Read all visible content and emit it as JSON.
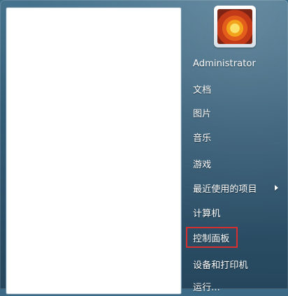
{
  "user": {
    "name": "Administrator"
  },
  "menu": {
    "items": [
      {
        "label": "文档",
        "submenu": false
      },
      {
        "label": "图片",
        "submenu": false
      },
      {
        "label": "音乐",
        "submenu": false
      },
      {
        "label": "游戏",
        "submenu": false
      },
      {
        "label": "最近使用的项目",
        "submenu": true
      },
      {
        "label": "计算机",
        "submenu": false
      },
      {
        "label": "控制面板",
        "submenu": false,
        "highlighted": true
      },
      {
        "label": "设备和打印机",
        "submenu": false
      },
      {
        "label": "运行...",
        "submenu": false
      }
    ]
  },
  "colors": {
    "panel_bg": "#2f5b77",
    "left_pane": "#ffffff",
    "highlight_border": "#d62f2f",
    "text": "#ffffff"
  }
}
